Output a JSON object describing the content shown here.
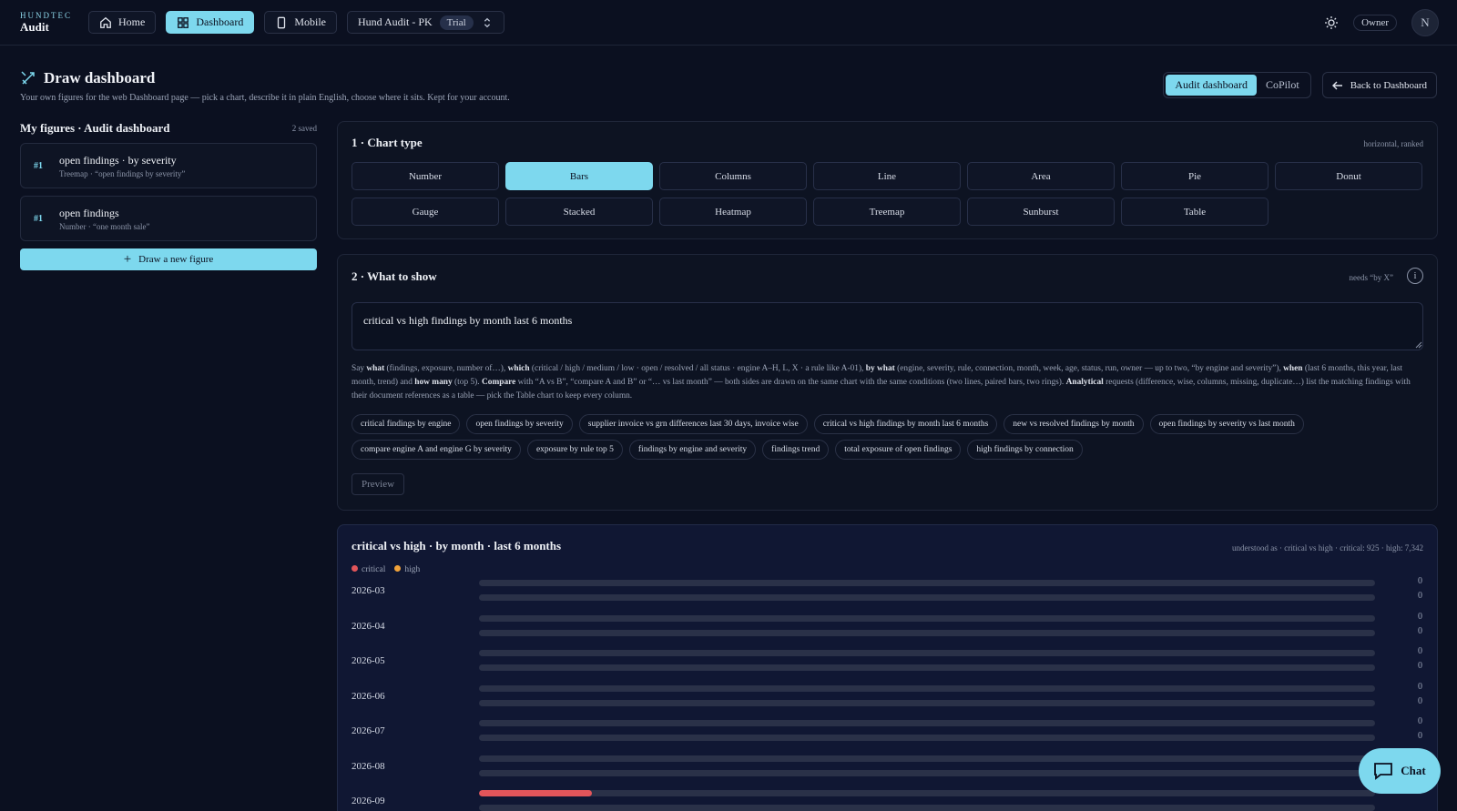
{
  "brand": {
    "top": "HUNDTEC",
    "bottom": "Audit"
  },
  "nav": {
    "home": "Home",
    "dashboard": "Dashboard",
    "mobile": "Mobile",
    "org": "Hund Audit - PK",
    "plan": "Trial"
  },
  "user": {
    "role": "Owner",
    "initial": "N"
  },
  "page": {
    "title": "Draw dashboard",
    "subtitle": "Your own figures for the web Dashboard page — pick a chart, describe it in plain English, choose where it sits. Kept for your account.",
    "seg_audit": "Audit dashboard",
    "seg_copilot": "CoPilot",
    "back": "Back to Dashboard"
  },
  "figures": {
    "title": "My figures · Audit dashboard",
    "count": "2 saved",
    "items": [
      {
        "rank": "#1",
        "name": "open findings · by severity",
        "meta": "Treemap · “open findings by severity”"
      },
      {
        "rank": "#1",
        "name": "open findings",
        "meta": "Number · “one month sale”"
      }
    ],
    "new_label": "Draw a new figure"
  },
  "chart_type": {
    "title": "1 · Chart type",
    "note": "horizontal, ranked",
    "types": [
      "Number",
      "Bars",
      "Columns",
      "Line",
      "Area",
      "Pie",
      "Donut",
      "Gauge",
      "Stacked",
      "Heatmap",
      "Treemap",
      "Sunburst",
      "Table"
    ],
    "selected": "Bars"
  },
  "what": {
    "title": "2 · What to show",
    "note": "needs “by X”",
    "query": "critical vs high findings by month last 6 months",
    "help_parts": [
      "Say ",
      "what",
      " (findings, exposure, number of…), ",
      "which",
      " (critical / high / medium / low · open / resolved / all status · engine A–H, L, X · a rule like A-01), ",
      "by what",
      " (engine, severity, rule, connection, month, week, age, status, run, owner — up to two, “by engine and severity”), ",
      "when",
      " (last 6 months, this year, last month, trend) and ",
      "how many",
      " (top 5). ",
      "Compare",
      " with “A vs B”, “compare A and B” or “… vs last month” — both sides are drawn on the same chart with the same conditions (two lines, paired bars, two rings). ",
      "Analytical",
      " requests (difference, wise, columns, missing, duplicate…) list the matching findings with their document references as a table — pick the Table chart to keep every column."
    ],
    "chips": [
      "critical findings by engine",
      "open findings by severity",
      "supplier invoice vs grn differences last 30 days, invoice wise",
      "critical vs high findings by month last 6 months",
      "new vs resolved findings by month",
      "open findings by severity vs last month",
      "compare engine A and engine G by severity",
      "exposure by rule top 5",
      "findings by engine and severity",
      "findings trend",
      "total exposure of open findings",
      "high findings by connection"
    ],
    "preview": "Preview"
  },
  "result": {
    "title": "critical vs high · by month · last 6 months",
    "understood": "understood as · critical vs high · critical: 925 · high: 7,342"
  },
  "chart_data": {
    "type": "bar",
    "orientation": "horizontal",
    "categories": [
      "2026-03",
      "2026-04",
      "2026-05",
      "2026-06",
      "2026-07",
      "2026-08",
      "2026-09"
    ],
    "series": [
      {
        "name": "critical",
        "color": "#e2555a",
        "values": [
          0,
          0,
          0,
          0,
          0,
          0,
          925
        ]
      },
      {
        "name": "high",
        "color": "#f0a23a",
        "values": [
          0,
          0,
          0,
          0,
          0,
          0,
          null
        ]
      }
    ],
    "xlim": [
      0,
      7342
    ]
  },
  "chat": {
    "label": "Chat"
  },
  "colors": {
    "accent": "#7dd8ee",
    "bg": "#0b1020"
  }
}
